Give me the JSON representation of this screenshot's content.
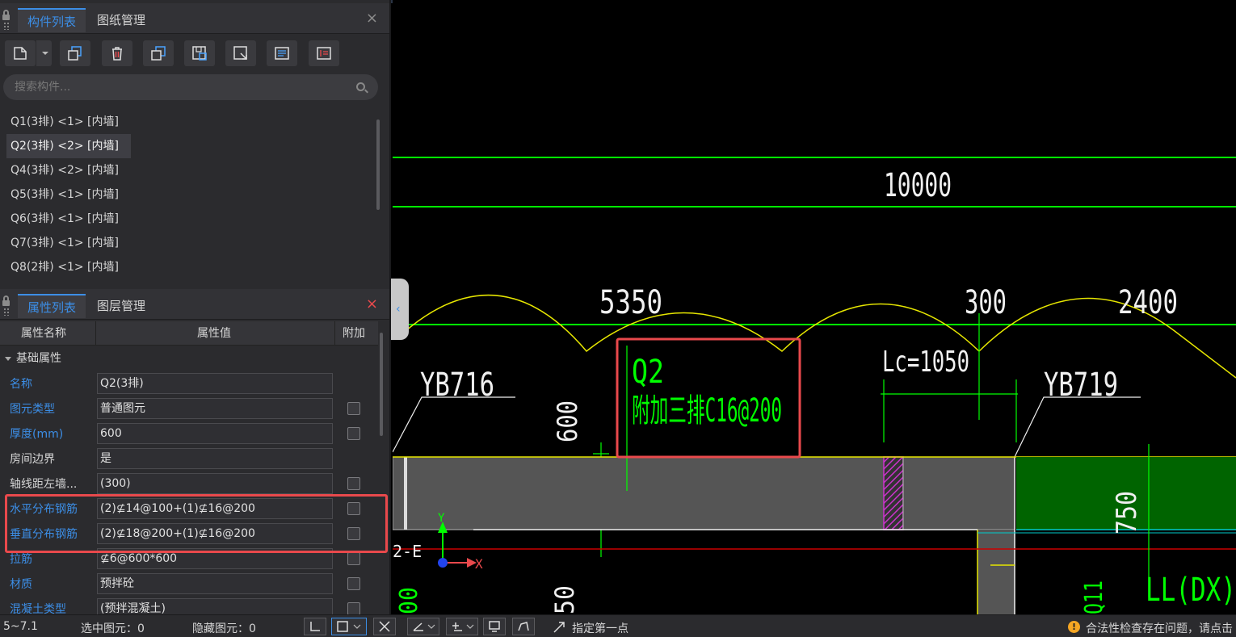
{
  "component_panel": {
    "tabs": [
      {
        "label": "构件列表",
        "active": true
      },
      {
        "label": "图纸管理",
        "active": false
      }
    ],
    "close": "×",
    "search_placeholder": "搜索构件...",
    "items": [
      {
        "label": "Q1(3排) <1> [内墙]",
        "selected": false
      },
      {
        "label": "Q2(3排) <2> [内墙]",
        "selected": true
      },
      {
        "label": "Q4(3排) <2> [内墙]",
        "selected": false
      },
      {
        "label": "Q5(3排) <1> [内墙]",
        "selected": false
      },
      {
        "label": "Q6(3排) <1> [内墙]",
        "selected": false
      },
      {
        "label": "Q7(3排) <1> [内墙]",
        "selected": false
      },
      {
        "label": "Q8(2排) <1> [内墙]",
        "selected": false
      }
    ]
  },
  "property_panel": {
    "tabs": [
      {
        "label": "属性列表",
        "active": true
      },
      {
        "label": "图层管理",
        "active": false
      }
    ],
    "close": "×",
    "columns": {
      "name": "属性名称",
      "value": "属性值",
      "extra": "附加"
    },
    "group": "基础属性",
    "rows": [
      {
        "name": "名称",
        "value": "Q2(3排)",
        "blue": true,
        "has_check": false
      },
      {
        "name": "图元类型",
        "value": "普通图元",
        "blue": true,
        "has_check": true
      },
      {
        "name": "厚度(mm)",
        "value": "600",
        "blue": true,
        "has_check": true
      },
      {
        "name": "房间边界",
        "value": "是",
        "blue": false,
        "has_check": false
      },
      {
        "name": "轴线距左墙...",
        "value": "(300)",
        "blue": false,
        "has_check": true
      },
      {
        "name": "水平分布钢筋",
        "value": "(2)⊈14@100+(1)⊈16@200",
        "blue": true,
        "has_check": true
      },
      {
        "name": "垂直分布钢筋",
        "value": "(2)⊈18@200+(1)⊈16@200",
        "blue": true,
        "has_check": true
      },
      {
        "name": "拉筋",
        "value": "⊈6@600*600",
        "blue": true,
        "has_check": true
      },
      {
        "name": "材质",
        "value": "预拌砼",
        "blue": true,
        "has_check": true
      },
      {
        "name": "混凝土类型",
        "value": "(预拌混凝土)",
        "blue": true,
        "has_check": true
      }
    ]
  },
  "drawing": {
    "dim_top": "10000",
    "dim_a": "5350",
    "dim_b": "300",
    "dim_c": "2400",
    "label_yb716": "YB716",
    "label_yb719": "YB719",
    "label_q2": "Q2",
    "label_rebar": "附加三排C16@200",
    "label_lc": "Lc=1050",
    "dim_600": "600",
    "dim_750": "750",
    "dim_50": "50",
    "label_ll": "LL(DX)",
    "label_q11": "Q11",
    "label_00": "00",
    "axis_label": "2-E",
    "axis_x": "X",
    "axis_y": "Y",
    "colors": {
      "green": "#00ff00",
      "yellow": "#e6e600",
      "red": "#e9494c",
      "wall": "#555555",
      "dark_green": "#006400",
      "magenta": "#cc33cc",
      "cyan": "#00cccc"
    }
  },
  "status_bar": {
    "coord": "5~7.1",
    "selected": "选中图元：0",
    "hidden": "隐藏图元：0",
    "prompt": "指定第一点",
    "warning": "合法性检查存在问题，请点击"
  }
}
